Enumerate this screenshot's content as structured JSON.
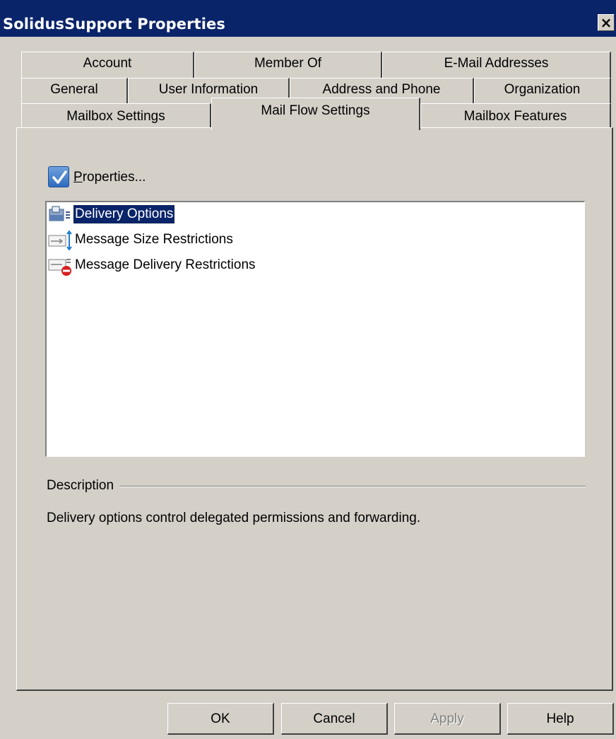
{
  "window": {
    "title": "SolidusSupport Properties",
    "close_glyph": "×"
  },
  "tabs": {
    "row1": [
      "Account",
      "Member Of",
      "E-Mail Addresses"
    ],
    "row2": [
      "General",
      "User Information",
      "Address and Phone",
      "Organization"
    ],
    "row3": [
      "Mailbox Settings",
      "Mail Flow Settings",
      "Mailbox Features"
    ],
    "active": "Mail Flow Settings"
  },
  "properties_checkbox": {
    "label_hotkey": "P",
    "label_rest": "roperties...",
    "checked": true
  },
  "list": {
    "items": [
      {
        "label": "Delivery Options",
        "icon": "delivery-options-icon",
        "selected": true
      },
      {
        "label": "Message Size Restrictions",
        "icon": "message-size-icon",
        "selected": false
      },
      {
        "label": "Message Delivery Restrictions",
        "icon": "delivery-restrictions-icon",
        "selected": false
      }
    ]
  },
  "description": {
    "label": "Description",
    "text": "Delivery options control delegated permissions and forwarding."
  },
  "buttons": {
    "ok": "OK",
    "cancel": "Cancel",
    "apply": "Apply",
    "help": "Help"
  },
  "colors": {
    "title_bar": "#0a246a",
    "face": "#d4d0c8",
    "selection": "#0a246a"
  }
}
